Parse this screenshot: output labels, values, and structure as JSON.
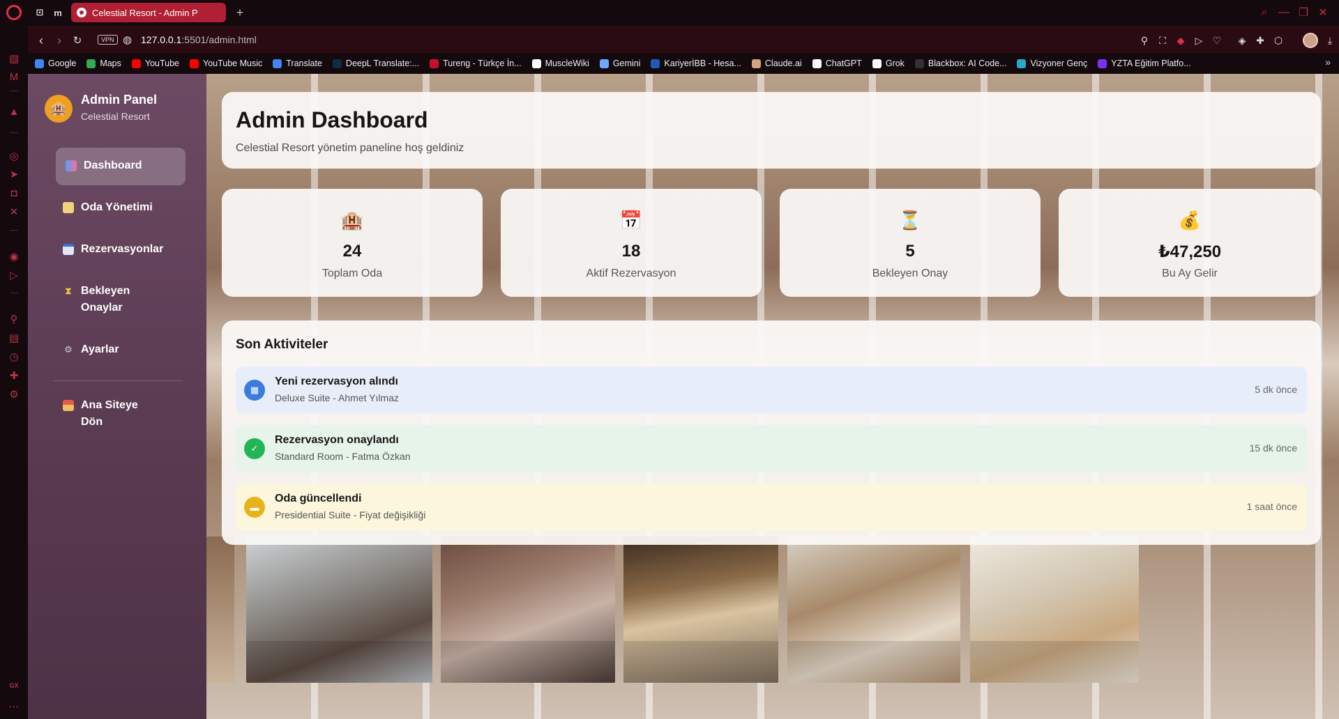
{
  "browser": {
    "tab_title": "Celestial Resort - Admin P",
    "new_tab": "+",
    "url_host": "127.0.0.1",
    "url_rest": ":5501/admin.html",
    "vpn_label": "VPN",
    "tabbar_m": "m",
    "bookmarks": [
      {
        "label": "Google",
        "color": "#4285f4"
      },
      {
        "label": "Maps",
        "color": "#34a853"
      },
      {
        "label": "YouTube",
        "color": "#ff0000"
      },
      {
        "label": "YouTube Music",
        "color": "#ff0000"
      },
      {
        "label": "Translate",
        "color": "#4285f4"
      },
      {
        "label": "DeepL Translate:...",
        "color": "#0f2b46"
      },
      {
        "label": "Tureng - Türkçe İn...",
        "color": "#c8102e"
      },
      {
        "label": "MuscleWiki",
        "color": "#ffffff"
      },
      {
        "label": "Gemini",
        "color": "#6ea8fe"
      },
      {
        "label": "KariyerİBB - Hesa...",
        "color": "#1e5bb8"
      },
      {
        "label": "Claude.ai",
        "color": "#d4a27f"
      },
      {
        "label": "ChatGPT",
        "color": "#ffffff"
      },
      {
        "label": "Grok",
        "color": "#ffffff"
      },
      {
        "label": "Blackbox: AI Code...",
        "color": "#333333"
      },
      {
        "label": "Vizyoner Genç",
        "color": "#2aa8c8"
      },
      {
        "label": "YZTA Eğitim Platfo...",
        "color": "#7b2ff7"
      }
    ],
    "sidebar_bottom_label": "GX"
  },
  "sidebar": {
    "title": "Admin Panel",
    "subtitle": "Celestial Resort",
    "items": [
      {
        "label": "Dashboard",
        "icon": "chart-icon",
        "active": true
      },
      {
        "label": "Oda Yönetimi",
        "icon": "hotel-icon"
      },
      {
        "label": "Rezervasyonlar",
        "icon": "calendar-icon"
      },
      {
        "label": "Bekleyen Onaylar",
        "icon": "hourglass-icon"
      },
      {
        "label": "Ayarlar",
        "icon": "gear-icon"
      },
      {
        "label": "Ana Siteye Dön",
        "icon": "house-icon"
      }
    ]
  },
  "header": {
    "title": "Admin Dashboard",
    "subtitle": "Celestial Resort yönetim paneline hoş geldiniz"
  },
  "stats": [
    {
      "icon": "🏨",
      "value": "24",
      "label": "Toplam Oda"
    },
    {
      "icon": "📅",
      "value": "18",
      "label": "Aktif Rezervasyon"
    },
    {
      "icon": "⏳",
      "value": "5",
      "label": "Bekleyen Onay"
    },
    {
      "icon": "💰",
      "value": "₺47,250",
      "label": "Bu Ay Gelir"
    }
  ],
  "activity": {
    "title": "Son Aktiviteler",
    "items": [
      {
        "title": "Yeni rezervasyon alındı",
        "desc": "Deluxe Suite - Ahmet Yılmaz",
        "time": "5 dk önce",
        "bg": "#e8eef9",
        "icon_bg": "#3b7be0",
        "icon": "▦"
      },
      {
        "title": "Rezervasyon onaylandı",
        "desc": "Standard Room - Fatma Özkan",
        "time": "15 dk önce",
        "bg": "#e6f4ea",
        "icon_bg": "#22b455",
        "icon": "✓"
      },
      {
        "title": "Oda güncellendi",
        "desc": "Presidential Suite - Fiyat değişikliği",
        "time": "1 saat önce",
        "bg": "#fbf6dc",
        "icon_bg": "#e8b21a",
        "icon": "▬"
      }
    ]
  }
}
